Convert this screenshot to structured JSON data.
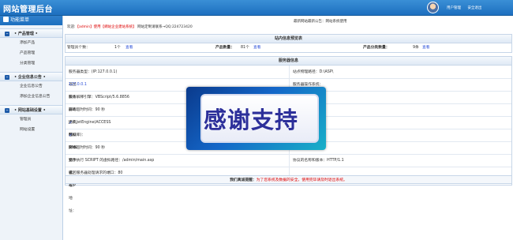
{
  "header": {
    "logo": "网站管理后台",
    "user_link": "用户管理",
    "logout_link": "安全退出"
  },
  "sidebar": {
    "title": "功能菜单",
    "groups": [
      {
        "label": "• 产品管理 •",
        "items": [
          "添加产品",
          "产品管理",
          "分类管理"
        ]
      },
      {
        "label": "• 企业信息公告 •",
        "items": [
          "企业信息公告",
          "添加企业信息公告"
        ]
      },
      {
        "label": "• 网站基础设置 •",
        "items": [
          "管理员",
          "网站设置"
        ]
      }
    ]
  },
  "main": {
    "notice": "最新网站最新公告：网站系统使用",
    "welcome_prefix": "欢迎:",
    "welcome_user": "【admin】",
    "welcome_role": "使用【網站企业建站系统】",
    "welcome_suffix": "网站定制请联系→QQ:224723420",
    "stats": {
      "title": "站内信息预览表",
      "admins_label": "管理员个数：",
      "admins_value": "1个",
      "admins_link": "查看",
      "products_label": "产品数量：",
      "products_value": "81个",
      "products_link": "查看",
      "categories_label": "产品分类数量：",
      "categories_value": "9条",
      "categories_link": "查看"
    },
    "server": {
      "title": "服务器信息",
      "rows": [
        {
          "left": "服务器类型：(IP:127.0.0.1)",
          "right": "站点物理路径：D:\\ASP\\"
        },
        {
          "left_label": "返回服务器的主机名：DNS别名，或IP地址：",
          "left_value": "127.0.0.1",
          "right": "服务器操作系统："
        },
        {
          "left": "脚本解释引擎：VBScript/5.6.8856",
          "right_label": "IIS版本：",
          "right_value": "Microsoft-IIS/6.0"
        },
        {
          "left": "脚本超时时间：90 秒",
          "right": ""
        },
        {
          "left": "JRO.JetEngine(ACCESS 数据库)：",
          "right": ""
        },
        {
          "left": "FSO文本文件读写：",
          "right": ""
        },
        {
          "left": "脚本超时时间：90 秒",
          "right": ""
        },
        {
          "left": "显示执行 SCRIPT 的虚拟路径：/admin/main.asp",
          "right": "协议的名称和版本：HTTP/1.1"
        },
        {
          "left": "返回服务器处理请求的端口：80",
          "right": ""
        }
      ]
    },
    "footer": {
      "label": "我们真诚提醒：",
      "message": "为了您系统及数据的安全，使用完毕请及时退出系统。"
    }
  },
  "overlay": {
    "text": "感谢支持"
  }
}
